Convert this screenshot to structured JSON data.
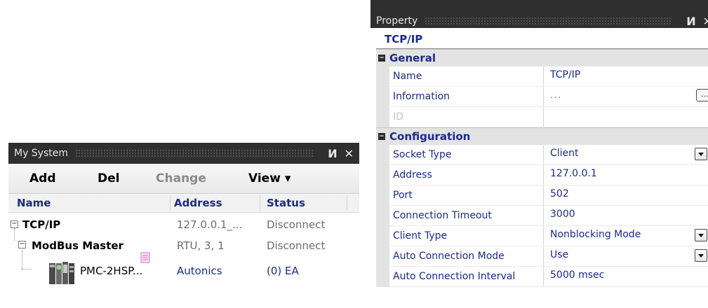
{
  "my_system": {
    "title": "My System",
    "pin_glyph": "И",
    "close_glyph": "✕",
    "toolbar": {
      "add": "Add",
      "del": "Del",
      "change": "Change",
      "view": "View ▾"
    },
    "columns": {
      "name": "Name",
      "address": "Address",
      "status": "Status"
    },
    "rows": [
      {
        "expander": "−",
        "name": "TCP/IP",
        "address": "127.0.0.1_...",
        "status": "Disconnect"
      },
      {
        "expander": "−",
        "name": "ModBus Master",
        "address": "RTU, 3, 1",
        "status": "Disconnect"
      },
      {
        "name": "PMC-2HSP...",
        "address": "Autonics",
        "status": "(0) EA"
      }
    ]
  },
  "property": {
    "title": "Property",
    "pin_glyph": "И",
    "close_glyph": "✕",
    "object_name": "TCP/IP",
    "ellipsis_label": "...",
    "categories": [
      {
        "toggle": "−",
        "name": "General",
        "rows": [
          {
            "name": "Name",
            "value": "TCP/IP"
          },
          {
            "name": "Information",
            "value": "..."
          },
          {
            "name": "ID",
            "value": ""
          }
        ]
      },
      {
        "toggle": "−",
        "name": "Configuration",
        "rows": [
          {
            "name": "Socket Type",
            "value": "Client"
          },
          {
            "name": "Address",
            "value": "127.0.0.1"
          },
          {
            "name": "Port",
            "value": "502"
          },
          {
            "name": "Connection Timeout",
            "value": "3000"
          },
          {
            "name": "Client Type",
            "value": "Nonblocking Mode"
          },
          {
            "name": "Auto Connection Mode",
            "value": "Use"
          },
          {
            "name": "Auto Connection Interval",
            "value": "5000 msec"
          }
        ]
      }
    ]
  },
  "colors": {
    "title_bar": "#2f2f2f",
    "label_blue": "#1b2a8a",
    "category_bg": "#e3e3e3",
    "disabled": "#8a8a8a"
  }
}
